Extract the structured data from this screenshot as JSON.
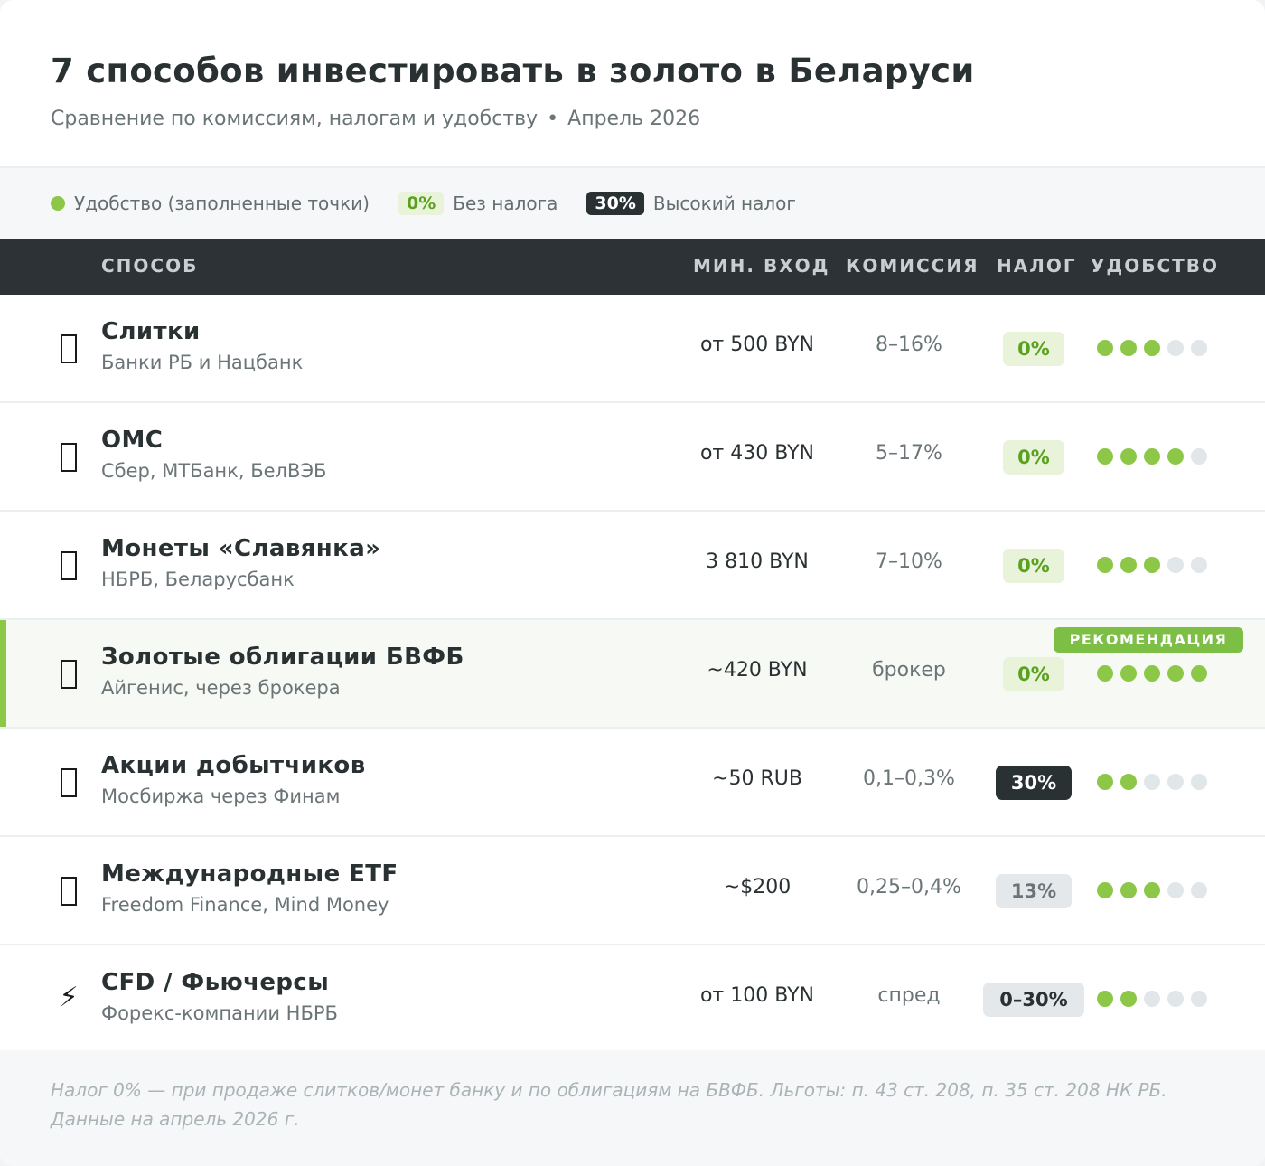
{
  "header": {
    "title": "7 способов инвестировать в золото в Беларуси",
    "subtitle": "Сравнение по комиссиям, налогам и удобству",
    "separator": "•",
    "date": "Апрель 2026"
  },
  "legend": {
    "convenience": "Удобство (заполненные точки)",
    "no_tax_chip": "0%",
    "no_tax_label": "Без налога",
    "high_tax_chip": "30%",
    "high_tax_label": "Высокий налог"
  },
  "columns": {
    "method": "СПОСОБ",
    "min_entry": "МИН. ВХОД",
    "commission": "КОМИССИЯ",
    "tax": "НАЛОГ",
    "convenience": "УДОБСТВО"
  },
  "rows": [
    {
      "icon": "gold-bar-icon",
      "name": "Слитки",
      "sub": "Банки РБ и Нацбанк",
      "min": "от 500 BYN",
      "fee": "8–16%",
      "tax": "0%",
      "tax_style": "green",
      "convenience": 3
    },
    {
      "icon": "bank-account-icon",
      "name": "ОМС",
      "sub": "Сбер, МТБанк, БелВЭБ",
      "min": "от 430 BYN",
      "fee": "5–17%",
      "tax": "0%",
      "tax_style": "green",
      "convenience": 4
    },
    {
      "icon": "coin-icon",
      "name": "Монеты «Славянка»",
      "sub": "НБРБ, Беларусбанк",
      "min": "3 810 BYN",
      "fee": "7–10%",
      "tax": "0%",
      "tax_style": "green",
      "convenience": 3
    },
    {
      "icon": "bond-icon",
      "name": "Золотые облигации БВФБ",
      "sub": "Айгенис, через брокера",
      "min": "~420 BYN",
      "fee": "брокер",
      "tax": "0%",
      "tax_style": "green",
      "convenience": 5,
      "badge": "РЕКОМЕНДАЦИЯ"
    },
    {
      "icon": "mining-icon",
      "name": "Акции добытчиков",
      "sub": "Мосбиржа через Финам",
      "min": "~50 RUB",
      "fee": "0,1–0,3%",
      "tax": "30%",
      "tax_style": "dark",
      "convenience": 2
    },
    {
      "icon": "globe-icon",
      "name": "Международные ETF",
      "sub": "Freedom Finance, Mind Money",
      "min": "~$200",
      "fee": "0,25–0,4%",
      "tax": "13%",
      "tax_style": "gray",
      "convenience": 3
    },
    {
      "icon": "lightning-icon",
      "name": "CFD / Фьючерсы",
      "sub": "Форекс-компании НБРБ",
      "min": "от 100 BYN",
      "fee": "спред",
      "tax": "0–30%",
      "tax_style": "gray-wide",
      "convenience": 2
    }
  ],
  "footer": "Налог 0% — при продаже слитков/монет банку и по облигациям на БВФБ. Льготы: п. 43 ст. 208, п. 35 ст. 208 НК РБ. Данные на апрель 2026 г.",
  "colors": {
    "accent_green": "#8cc748",
    "dark": "#2a3133",
    "muted": "#6b7578"
  }
}
